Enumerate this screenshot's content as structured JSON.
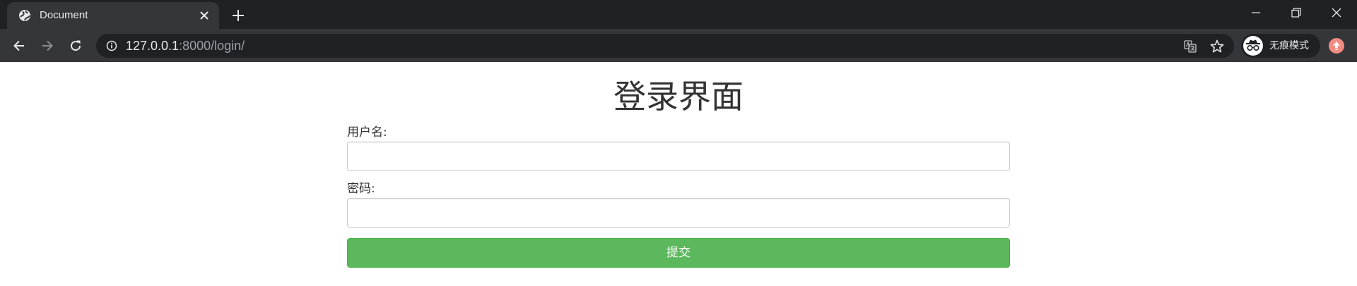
{
  "browser": {
    "tab": {
      "title": "Document",
      "favicon": "globe-icon"
    },
    "address_bar": {
      "host": "127.0.0.1",
      "path": ":8000/login/"
    },
    "incognito_label": "无痕模式",
    "colors": {
      "tabbar": "#202124",
      "toolbar": "#35363a",
      "update_badge": "#f28b82"
    }
  },
  "page": {
    "title": "登录界面",
    "form": {
      "username_label": "用户名:",
      "username_value": "",
      "password_label": "密码:",
      "password_value": "",
      "submit_label": "提交"
    },
    "colors": {
      "submit_button": "#5cb85c",
      "text": "#333333"
    }
  }
}
